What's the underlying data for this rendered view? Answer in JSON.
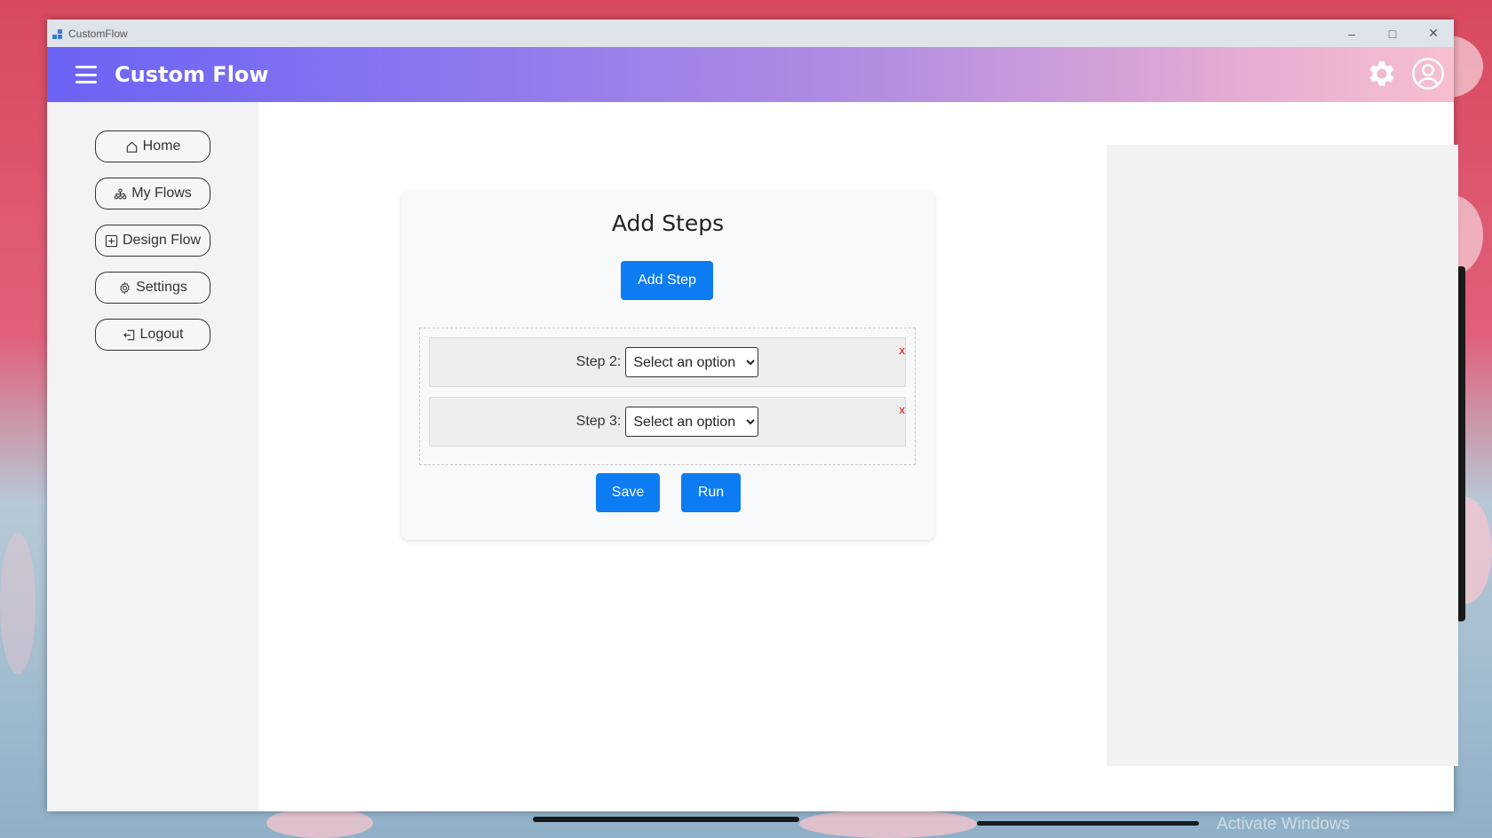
{
  "window": {
    "title": "CustomFlow",
    "controls": [
      "minimize-icon",
      "maximize-icon",
      "close-icon"
    ]
  },
  "appbar": {
    "title": "Custom Flow",
    "gradient": [
      "#6a63f5",
      "#f7bfd0"
    ],
    "icons": [
      "settings-icon",
      "account-icon"
    ]
  },
  "sidebar": {
    "items": [
      {
        "label": "Home",
        "icon": "home-icon"
      },
      {
        "label": "My Flows",
        "icon": "flows-icon"
      },
      {
        "label": "Design Flow",
        "icon": "plus-box-icon"
      },
      {
        "label": "Settings",
        "icon": "gear-icon"
      },
      {
        "label": "Logout",
        "icon": "logout-icon"
      }
    ]
  },
  "card": {
    "title": "Add Steps",
    "add_step_label": "Add Step",
    "steps": [
      {
        "label": "Step 2:",
        "select_value": "Select an option",
        "remove": "x"
      },
      {
        "label": "Step 3:",
        "select_value": "Select an option",
        "remove": "x"
      }
    ],
    "save_label": "Save",
    "run_label": "Run"
  },
  "colors": {
    "primary": "#0d7cf2",
    "remove": "#ee0000"
  },
  "desktop": {
    "watermark": "Activate Windows"
  }
}
